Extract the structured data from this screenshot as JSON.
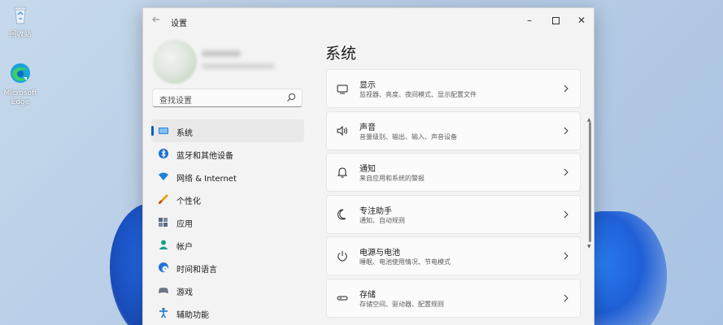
{
  "desktop": {
    "recycle_bin_label": "回收站",
    "edge_label": "Microsoft Edge"
  },
  "window": {
    "title": "设置",
    "controls": {
      "minimize": "–",
      "close": "✕"
    }
  },
  "sidebar": {
    "search_placeholder": "查找设置",
    "items": [
      {
        "label": "系统",
        "icon": "monitor-icon",
        "active": true
      },
      {
        "label": "蓝牙和其他设备",
        "icon": "bluetooth-icon"
      },
      {
        "label": "网络 & Internet",
        "icon": "wifi-icon"
      },
      {
        "label": "个性化",
        "icon": "brush-icon"
      },
      {
        "label": "应用",
        "icon": "apps-icon"
      },
      {
        "label": "帐户",
        "icon": "account-icon"
      },
      {
        "label": "时间和语言",
        "icon": "globe-clock-icon"
      },
      {
        "label": "游戏",
        "icon": "gamepad-icon"
      },
      {
        "label": "辅助功能",
        "icon": "accessibility-icon"
      }
    ]
  },
  "main": {
    "title": "系统",
    "cards": [
      {
        "title": "显示",
        "subtitle": "监视器、亮度、夜间模式、显示配置文件",
        "icon": "display-icon"
      },
      {
        "title": "声音",
        "subtitle": "音量级别、输出、输入、声音设备",
        "icon": "speaker-icon"
      },
      {
        "title": "通知",
        "subtitle": "来自应用和系统的警报",
        "icon": "bell-icon"
      },
      {
        "title": "专注助手",
        "subtitle": "通知、自动规则",
        "icon": "moon-icon"
      },
      {
        "title": "电源与电池",
        "subtitle": "睡眠、电池使用情况、节电模式",
        "icon": "power-icon"
      },
      {
        "title": "存储",
        "subtitle": "存储空间、驱动器、配置规则",
        "icon": "storage-icon"
      }
    ]
  },
  "colors": {
    "accent": "#005fb8",
    "window_bg": "#f3f3f3",
    "card_bg": "#fbfbfb"
  }
}
